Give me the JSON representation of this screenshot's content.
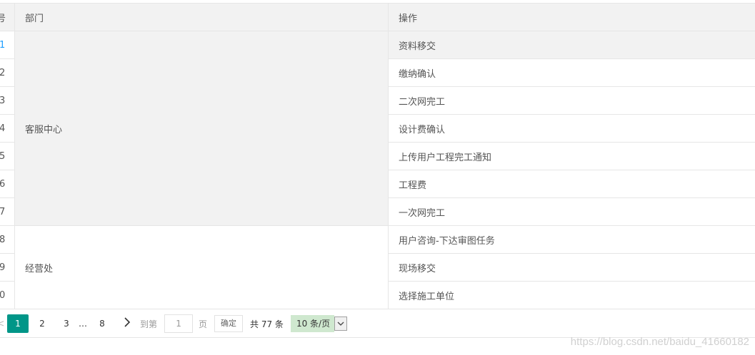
{
  "table": {
    "headers": {
      "index": "号",
      "department": "部门",
      "operation": "操作"
    },
    "rows": [
      {
        "index": "1",
        "operation": "资料移交"
      },
      {
        "index": "2",
        "operation": "缴纳确认"
      },
      {
        "index": "3",
        "operation": "二次网完工"
      },
      {
        "index": "4",
        "operation": "设计费确认"
      },
      {
        "index": "5",
        "operation": "上传用户工程完工通知"
      },
      {
        "index": "6",
        "operation": "工程费"
      },
      {
        "index": "7",
        "operation": "一次网完工"
      },
      {
        "index": "8",
        "operation": "用户咨询-下达审图任务"
      },
      {
        "index": "9",
        "operation": "现场移交"
      },
      {
        "index": "0",
        "operation": "选择施工单位"
      }
    ],
    "departments": [
      {
        "name": "客服中心",
        "rowspan": 7
      },
      {
        "name": "经营处",
        "rowspan": 3
      }
    ]
  },
  "pager": {
    "prev_glyph": "<",
    "pages": [
      "1",
      "2",
      "3"
    ],
    "current": "1",
    "ellipsis": "…",
    "last": "8",
    "next_glyph": "›",
    "skip_label": "到第",
    "skip_value": "1",
    "page_unit": "页",
    "confirm_label": "确定",
    "total": "共 77 条",
    "limit": "10 条/页"
  },
  "watermark": "https://blog.csdn.net/baidu_41660182",
  "colors": {
    "current_page": "#009688",
    "active_index": "#1e9fff",
    "header_bg": "#f2f2f2"
  }
}
